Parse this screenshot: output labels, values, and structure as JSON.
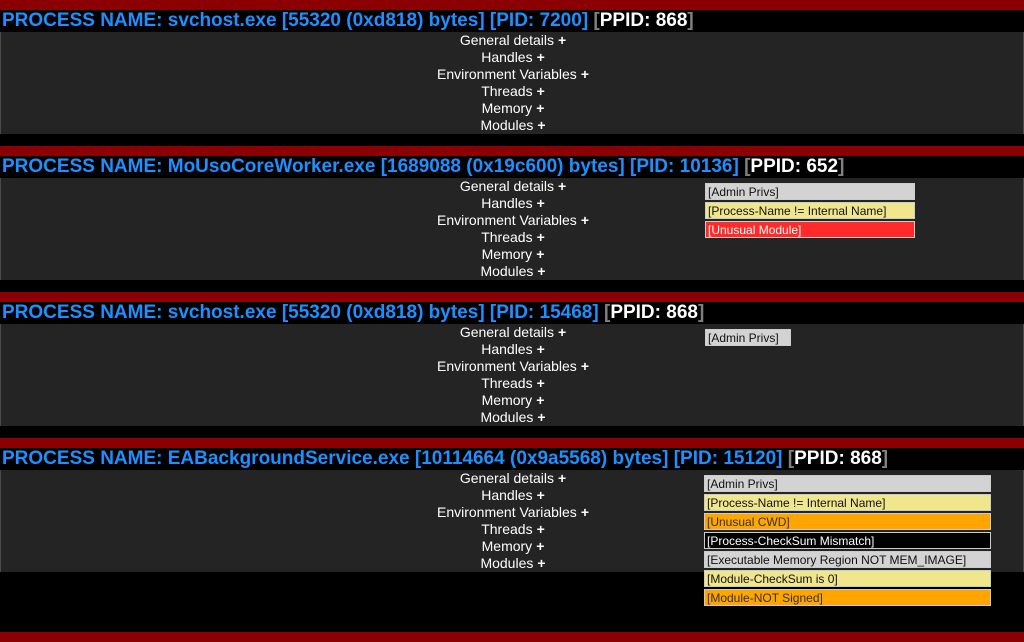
{
  "processes": [
    {
      "name": "svchost.exe",
      "size": "55320",
      "hex": "0xd818",
      "pid": "7200",
      "ppid": "868",
      "flags": []
    },
    {
      "name": "MoUsoCoreWorker.exe",
      "size": "1689088",
      "hex": "0x19c600",
      "pid": "10136",
      "ppid": "652",
      "flags": [
        {
          "label": "[Admin Privs]",
          "color": "#d3d3d3"
        },
        {
          "label": "[Process-Name != Internal Name]",
          "color": "#f0e68c"
        },
        {
          "label": "[Unusual Module]",
          "color": "#ff2a2a"
        }
      ]
    },
    {
      "name": "svchost.exe",
      "size": "55320",
      "hex": "0xd818",
      "pid": "15468",
      "ppid": "868",
      "flags": [
        {
          "label": "[Admin Privs]",
          "color": "#d3d3d3"
        }
      ]
    },
    {
      "name": "EABackgroundService.exe",
      "size": "10114664",
      "hex": "0x9a5568",
      "pid": "15120",
      "ppid": "868",
      "flags": [
        {
          "label": "[Admin Privs]",
          "color": "#d3d3d3"
        },
        {
          "label": "[Process-Name != Internal Name]",
          "color": "#f0e68c"
        },
        {
          "label": "[Unusual CWD]",
          "color": "#ffa500"
        },
        {
          "label": "[Process-CheckSum Mismatch]",
          "color": "#000000"
        },
        {
          "label": "[Executable Memory Region NOT MEM_IMAGE]",
          "color": "#d3d3d3"
        },
        {
          "label": "[Module-CheckSum is 0]",
          "color": "#f0e68c"
        },
        {
          "label": "[Module-NOT Signed]",
          "color": "#ffa500"
        }
      ]
    }
  ],
  "labels": {
    "process_prefix": "PROCESS NAME: ",
    "bytes_word": "bytes",
    "pid_prefix": "PID: ",
    "ppid_prefix": "PPID: ",
    "expand": "+"
  },
  "sections": [
    "General details",
    "Handles",
    "Environment Variables",
    "Threads",
    "Memory",
    "Modules"
  ]
}
